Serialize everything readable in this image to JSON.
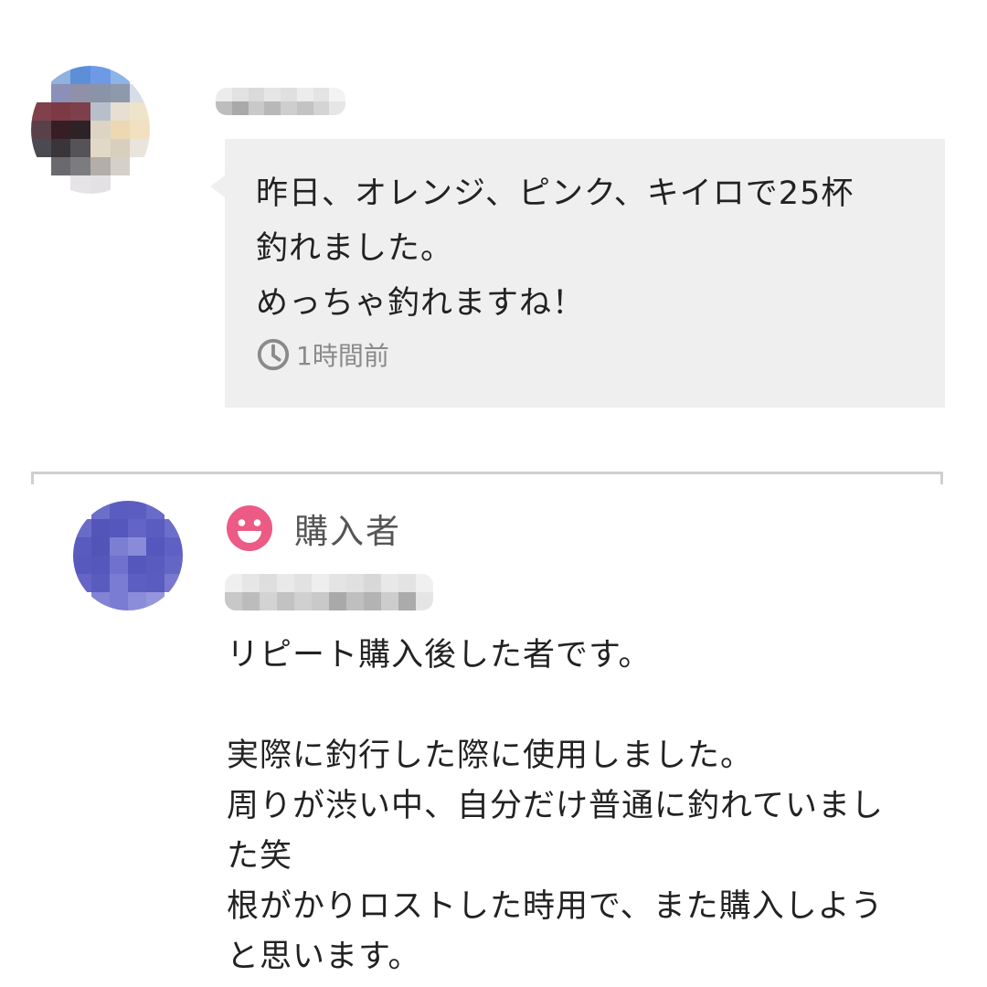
{
  "comments": [
    {
      "avatar": {
        "pixels": [
          "#ffffff",
          "#8fb2df",
          "#5d8fd9",
          "#6d9ae6",
          "#8eb3e6",
          "#ffffff",
          "#ffffff",
          "#8a90b8",
          "#9090a8",
          "#8a93a8",
          "#8e99ab",
          "#d6dce8",
          "#80404c",
          "#7c3a45",
          "#7c3f4b",
          "#b7bfca",
          "#e7dfd2",
          "#efe3c9",
          "#5a4048",
          "#361e24",
          "#2d2326",
          "#ddd4c4",
          "#ecd9b4",
          "#f2e1c0",
          "#4b4a50",
          "#3a3538",
          "#555357",
          "#e2d8c7",
          "#d9cfbe",
          "#e9e4dc",
          "#ffffff",
          "#6a6a6e",
          "#7c7b80",
          "#b3aeaa",
          "#d6d0ca",
          "#ffffff",
          "#ffffff",
          "#ffffff",
          "#e6e4e6",
          "#e3e1e4",
          "#ffffff",
          "#ffffff"
        ]
      },
      "username_mosaic": [
        "#ececec",
        "#e2e2e2",
        "#dadada",
        "#e6e6e6",
        "#e0e0e0",
        "#ececec",
        "#e4e4e4",
        "#f3f3f3",
        "#bdbdbd",
        "#a9a9a9",
        "#c9c9c9",
        "#b8b8b8",
        "#cecece",
        "#c3c3c3",
        "#d4d4d4",
        "#e6e6e6"
      ],
      "body": "昨日、オレンジ、ピンク、キイロで25杯\n釣れました。\nめっちゃ釣れますね！",
      "time": "1時間前"
    },
    {
      "avatar": {
        "pixels": [
          "#ffffff",
          "#6d6ec9",
          "#5b5cc0",
          "#5b5dc0",
          "#6a6bc8",
          "#ffffff",
          "#6a6bc8",
          "#5355b9",
          "#5557bd",
          "#6364c6",
          "#5b5cc0",
          "#6d6ec9",
          "#5a5bbf",
          "#5354b8",
          "#7c7ed2",
          "#8a8bd8",
          "#5557bd",
          "#5f60c3",
          "#5859bd",
          "#5557bb",
          "#6f71cd",
          "#5657bc",
          "#5a5bbf",
          "#6466c6",
          "#6465c6",
          "#5a5bbf",
          "#7a7bd2",
          "#5d5ec1",
          "#5b5cc0",
          "#7778ce",
          "#ffffff",
          "#8283d5",
          "#7a7bd2",
          "#8c8dda",
          "#9596dd",
          "#ffffff"
        ]
      },
      "badge_label": "購入者",
      "username_mosaic": [
        "#efefef",
        "#e6e6e6",
        "#dedede",
        "#e9e9e9",
        "#e2e2e2",
        "#eeeeee",
        "#e4e4e4",
        "#e0e0e0",
        "#d8d8d8",
        "#e8e8e8",
        "#e3e3e3",
        "#f0f0f0",
        "#c8c8c8",
        "#bcbcbc",
        "#d3d3d3",
        "#c2c2c2",
        "#d0d0d0",
        "#c9c9c9",
        "#a9a9a9",
        "#bfbfbf",
        "#b3b3b3",
        "#cdcdcd",
        "#ababab",
        "#e5e5e5"
      ],
      "body_lines": [
        "リピート購入後した者です。",
        "",
        "実際に釣行した際に使用しました。",
        "周りが渋い中、自分だけ普通に釣れていまし",
        "た笑",
        "根がかりロストした時用で、また購入しよう",
        "と思います。"
      ]
    }
  ],
  "icons": {
    "time": "clock-icon",
    "buyer": "smiley-face-icon"
  },
  "colors": {
    "bubble_bg": "#efefef",
    "text": "#222222",
    "muted": "#8a8a8a",
    "buyer_icon": "#ec5a86",
    "divider": "#cfcfcf"
  }
}
